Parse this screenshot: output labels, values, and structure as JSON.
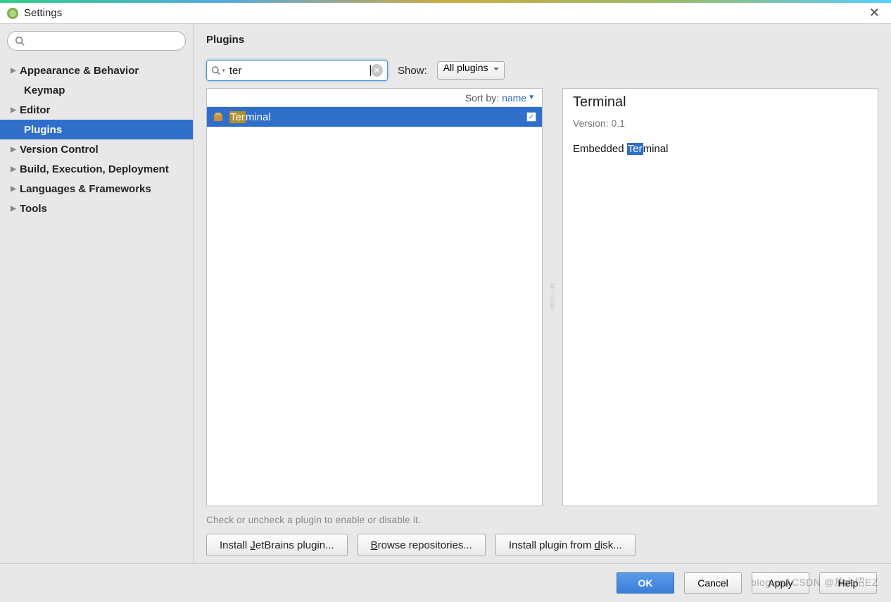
{
  "window": {
    "title": "Settings"
  },
  "sidebar": {
    "items": [
      {
        "label": "Appearance & Behavior",
        "expandable": true
      },
      {
        "label": "Keymap",
        "expandable": false
      },
      {
        "label": "Editor",
        "expandable": true
      },
      {
        "label": "Plugins",
        "expandable": false,
        "child": true,
        "selected": true
      },
      {
        "label": "Version Control",
        "expandable": true
      },
      {
        "label": "Build, Execution, Deployment",
        "expandable": true
      },
      {
        "label": "Languages & Frameworks",
        "expandable": true
      },
      {
        "label": "Tools",
        "expandable": true
      }
    ]
  },
  "main": {
    "title": "Plugins",
    "search_value": "ter",
    "show_label": "Show:",
    "show_value": "All plugins",
    "sort_prefix": "Sort by:",
    "sort_value": "name",
    "results": [
      {
        "highlight": "Ter",
        "rest": "minal",
        "checked": true
      }
    ],
    "detail": {
      "title": "Terminal",
      "version_label": "Version: 0.1",
      "desc_prefix": "Embedded ",
      "desc_highlight": "Ter",
      "desc_rest": "minal"
    },
    "hint": "Check or uncheck a plugin to enable or disable it.",
    "buttons": {
      "install_jb": {
        "pre": "Install ",
        "ul": "J",
        "post": "etBrains plugin..."
      },
      "browse": {
        "pre": "",
        "ul": "B",
        "post": "rowse repositories..."
      },
      "from_disk": {
        "pre": "Install plugin from ",
        "ul": "d",
        "post": "isk..."
      }
    }
  },
  "footer": {
    "ok": "OK",
    "cancel": "Cancel",
    "apply": "Apply",
    "help": "Help"
  },
  "watermark": "blog.csACSDN @放大招EZ"
}
